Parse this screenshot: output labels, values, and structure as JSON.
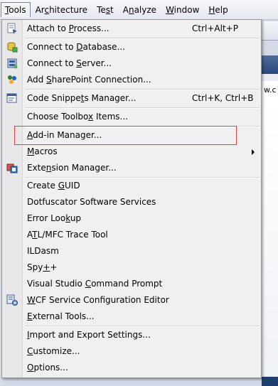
{
  "menubar": {
    "items": [
      {
        "label": "Tools",
        "mnemonic": "T",
        "active": true
      },
      {
        "label": "Architecture",
        "mnemonic": "c"
      },
      {
        "label": "Test",
        "mnemonic": "s"
      },
      {
        "label": "Analyze",
        "mnemonic": "n"
      },
      {
        "label": "Window",
        "mnemonic": "W"
      },
      {
        "label": "Help",
        "mnemonic": "H"
      }
    ]
  },
  "background": {
    "fragment_text": "w.c"
  },
  "dropdown": {
    "items": [
      {
        "label": "Attach to Process...",
        "mnemonic": "P",
        "shortcut": "Ctrl+Alt+P",
        "icon": "attach-process-icon"
      },
      {
        "label": "Connect to Database...",
        "mnemonic": "D",
        "shortcut": "",
        "icon": "connect-database-icon"
      },
      {
        "label": "Connect to Server...",
        "mnemonic": "S",
        "shortcut": "",
        "icon": "connect-server-icon"
      },
      {
        "label": "Add SharePoint Connection...",
        "mnemonic": "S",
        "shortcut": "",
        "icon": "sharepoint-connection-icon"
      },
      {
        "label": "Code Snippets Manager...",
        "mnemonic": "t",
        "shortcut": "Ctrl+K, Ctrl+B",
        "icon": "code-snippets-icon"
      },
      {
        "label": "Choose Toolbox Items...",
        "mnemonic": "x",
        "shortcut": "",
        "icon": ""
      },
      {
        "label": "Add-in Manager...",
        "mnemonic": "A",
        "shortcut": "",
        "icon": ""
      },
      {
        "label": "Macros",
        "mnemonic": "M",
        "shortcut": "",
        "icon": "",
        "submenu": true
      },
      {
        "label": "Extension Manager...",
        "mnemonic": "n",
        "shortcut": "",
        "icon": "extension-manager-icon"
      },
      {
        "label": "Create GUID",
        "mnemonic": "G",
        "shortcut": "",
        "icon": ""
      },
      {
        "label": "Dotfuscator Software Services",
        "mnemonic": "",
        "shortcut": "",
        "icon": ""
      },
      {
        "label": "Error Lookup",
        "mnemonic": "k",
        "shortcut": "",
        "icon": ""
      },
      {
        "label": "ATL/MFC Trace Tool",
        "mnemonic": "T",
        "shortcut": "",
        "icon": ""
      },
      {
        "label": "ILDasm",
        "mnemonic": "",
        "shortcut": "",
        "icon": ""
      },
      {
        "label": "Spy++",
        "mnemonic": "+",
        "shortcut": "",
        "icon": ""
      },
      {
        "label": "Visual Studio Command Prompt",
        "mnemonic": "C",
        "shortcut": "",
        "icon": ""
      },
      {
        "label": "WCF Service Configuration Editor",
        "mnemonic": "W",
        "shortcut": "",
        "icon": "wcf-config-icon"
      },
      {
        "label": "External Tools...",
        "mnemonic": "E",
        "shortcut": "",
        "icon": ""
      },
      {
        "label": "Import and Export Settings...",
        "mnemonic": "I",
        "shortcut": "",
        "icon": ""
      },
      {
        "label": "Customize...",
        "mnemonic": "C",
        "shortcut": "",
        "icon": ""
      },
      {
        "label": "Options...",
        "mnemonic": "O",
        "shortcut": "",
        "icon": ""
      }
    ]
  },
  "annotation": {
    "highlighted_item": "Add-in Manager...",
    "color": "#e0443c"
  }
}
